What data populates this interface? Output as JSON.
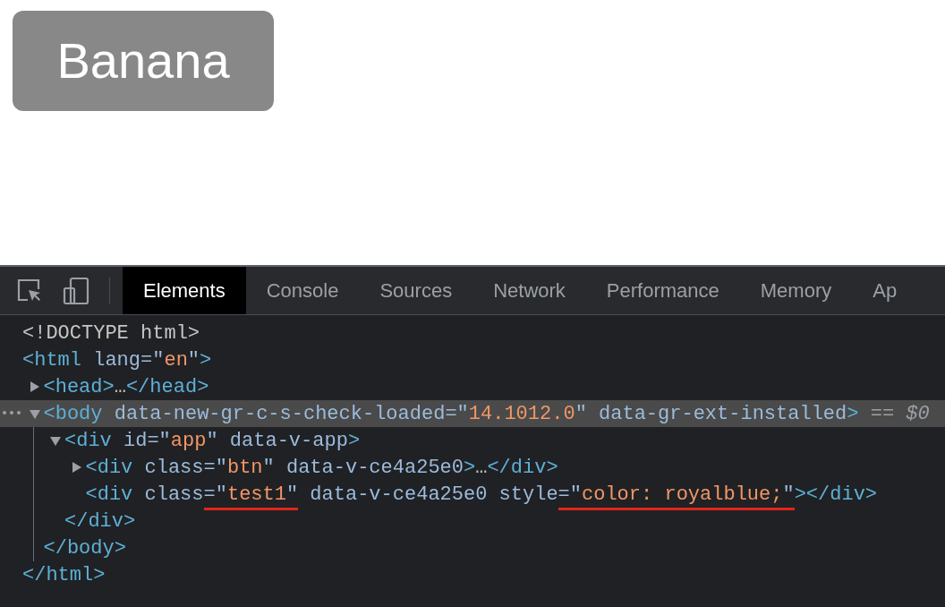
{
  "page": {
    "button": {
      "label": "Banana"
    }
  },
  "devtools": {
    "tabs": [
      {
        "label": "Elements",
        "selected": true
      },
      {
        "label": "Console",
        "selected": false
      },
      {
        "label": "Sources",
        "selected": false
      },
      {
        "label": "Network",
        "selected": false
      },
      {
        "label": "Performance",
        "selected": false
      },
      {
        "label": "Memory",
        "selected": false
      },
      {
        "label": "Ap",
        "selected": false
      }
    ],
    "dom_tree": [
      {
        "tokens": [
          {
            "kind": "doctype",
            "text": "<!DOCTYPE html>"
          }
        ]
      },
      {
        "tokens": [
          {
            "kind": "tag",
            "text": "<html"
          },
          {
            "kind": "attr",
            "text": " lang=\""
          },
          {
            "kind": "value",
            "text": "en"
          },
          {
            "kind": "attr",
            "text": "\""
          },
          {
            "kind": "tag",
            "text": ">"
          }
        ],
        "closing": [
          {
            "kind": "tag",
            "text": "</html>"
          }
        ],
        "children": [
          {
            "expanded": false,
            "tokens": [
              {
                "kind": "tag",
                "text": "<head>"
              },
              {
                "kind": "plain",
                "text": "…"
              },
              {
                "kind": "tag",
                "text": "</head>"
              }
            ]
          },
          {
            "expanded": true,
            "selected": true,
            "tokens": [
              {
                "kind": "tag",
                "text": "<body"
              },
              {
                "kind": "attr",
                "text": " data-new-gr-c-s-check-loaded=\""
              },
              {
                "kind": "value",
                "text": "14.1012.0"
              },
              {
                "kind": "attr",
                "text": "\" data-gr-ext-installed"
              },
              {
                "kind": "tag",
                "text": ">"
              },
              {
                "kind": "dim",
                "text": " == "
              },
              {
                "kind": "ref",
                "text": "$0"
              }
            ],
            "closing": [
              {
                "kind": "tag",
                "text": "</body>"
              }
            ],
            "children": [
              {
                "expanded": true,
                "tokens": [
                  {
                    "kind": "tag",
                    "text": "<div"
                  },
                  {
                    "kind": "attr",
                    "text": " id=\""
                  },
                  {
                    "kind": "value",
                    "text": "app"
                  },
                  {
                    "kind": "attr",
                    "text": "\" data-v-app"
                  },
                  {
                    "kind": "tag",
                    "text": ">"
                  }
                ],
                "closing": [
                  {
                    "kind": "tag",
                    "text": "</div>"
                  }
                ],
                "children": [
                  {
                    "expanded": false,
                    "tokens": [
                      {
                        "kind": "tag",
                        "text": "<div"
                      },
                      {
                        "kind": "attr",
                        "text": " class=\""
                      },
                      {
                        "kind": "value",
                        "text": "btn"
                      },
                      {
                        "kind": "attr",
                        "text": "\" data-v-ce4a25e0"
                      },
                      {
                        "kind": "tag",
                        "text": ">"
                      },
                      {
                        "kind": "plain",
                        "text": "…"
                      },
                      {
                        "kind": "tag",
                        "text": "</div>"
                      }
                    ]
                  },
                  {
                    "tokens": [
                      {
                        "kind": "tag",
                        "text": "<div"
                      },
                      {
                        "kind": "attr",
                        "text": " class"
                      },
                      {
                        "kind": "attr",
                        "text": "=\"",
                        "underlined": true
                      },
                      {
                        "kind": "value",
                        "text": "test1",
                        "underlined": true
                      },
                      {
                        "kind": "attr",
                        "text": "\"",
                        "underlined": true
                      },
                      {
                        "kind": "attr",
                        "text": " data-v-ce4a25e0 style"
                      },
                      {
                        "kind": "attr",
                        "text": "=\"",
                        "underlined": true
                      },
                      {
                        "kind": "value",
                        "text": "color: royalblue;",
                        "underlined": true
                      },
                      {
                        "kind": "attr",
                        "text": "\"",
                        "underlined": true
                      },
                      {
                        "kind": "tag",
                        "text": "></div>"
                      }
                    ]
                  }
                ]
              }
            ]
          }
        ]
      }
    ]
  }
}
